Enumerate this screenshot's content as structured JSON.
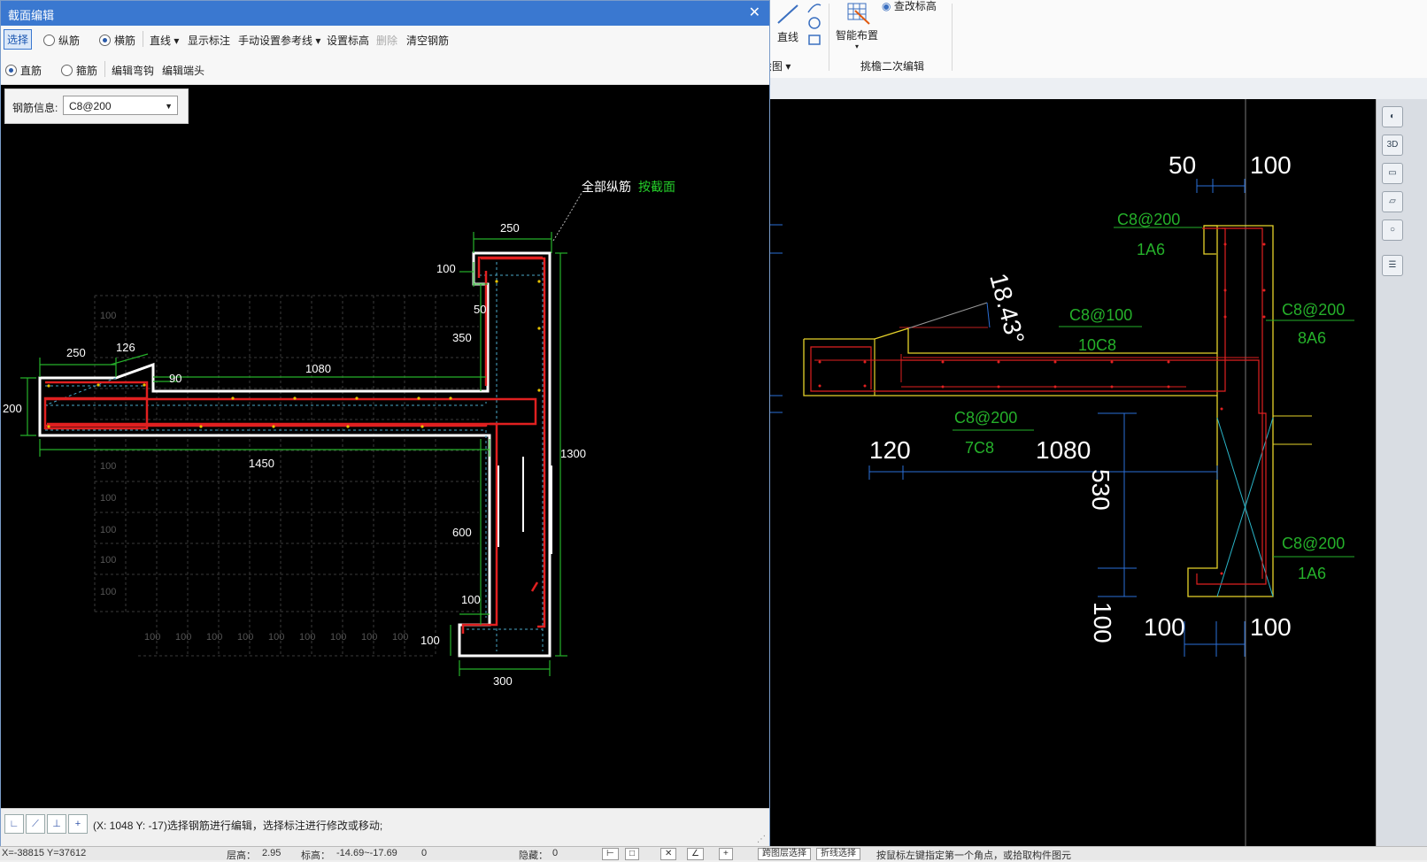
{
  "dialog": {
    "title": "截面编辑",
    "close": "✕",
    "toolbar1": {
      "select": "选择",
      "longitudinal": "纵筋",
      "transverse": "横筋",
      "line": "直线 ▾",
      "show_dim": "显示标注",
      "manual_ref": "手动设置参考线 ▾",
      "set_elev": "设置标高",
      "delete": "删除",
      "clear": "清空钢筋"
    },
    "toolbar2": {
      "straight": "直筋",
      "stirrup": "箍筋",
      "edit_hook": "编辑弯钩",
      "edit_end": "编辑端头"
    },
    "rebar_info": {
      "label": "钢筋信息:",
      "value": "C8@200"
    },
    "status": "(X: 1048 Y: -17)选择钢筋进行编辑，选择标注进行修改或移动;"
  },
  "ribbon": {
    "line_btn": "直线",
    "smart_layout": "智能布置",
    "check_elev": "查改标高",
    "draw_group": "绘图 ▾",
    "group2": "挑檐二次编辑"
  },
  "left_drawing": {
    "note_all": "全部纵筋",
    "note_section": "按截面",
    "dims": [
      "250",
      "100",
      "50",
      "350",
      "1300",
      "600",
      "100",
      "100",
      "300",
      "250",
      "126",
      "90",
      "1080",
      "200",
      "1450"
    ],
    "grid_label": "100"
  },
  "right_drawing": {
    "dims": [
      "50",
      "100",
      "18.43°",
      "120",
      "1080",
      "530",
      "100",
      "100",
      "100"
    ],
    "labels": [
      {
        "t": "C8@200",
        "s": "1A6"
      },
      {
        "t": "C8@100",
        "s": "10C8"
      },
      {
        "t": "C8@200",
        "s": "8A6"
      },
      {
        "t": "C8@200",
        "s": "7C8"
      },
      {
        "t": "C8@200",
        "s": "1A6"
      }
    ]
  },
  "bottom": {
    "coords": "X=-38815 Y=37612",
    "thick": "层高：",
    "thick_val": "2.95",
    "elev": "标高：",
    "elev_val": "-14.69~-17.69",
    "count": "0",
    "hidden": "隐藏：",
    "hidden_val": "0",
    "btn1": "跨图层选择",
    "btn2": "折线选择",
    "hint": "按鼠标左键指定第一个角点，或拾取构件图元"
  }
}
